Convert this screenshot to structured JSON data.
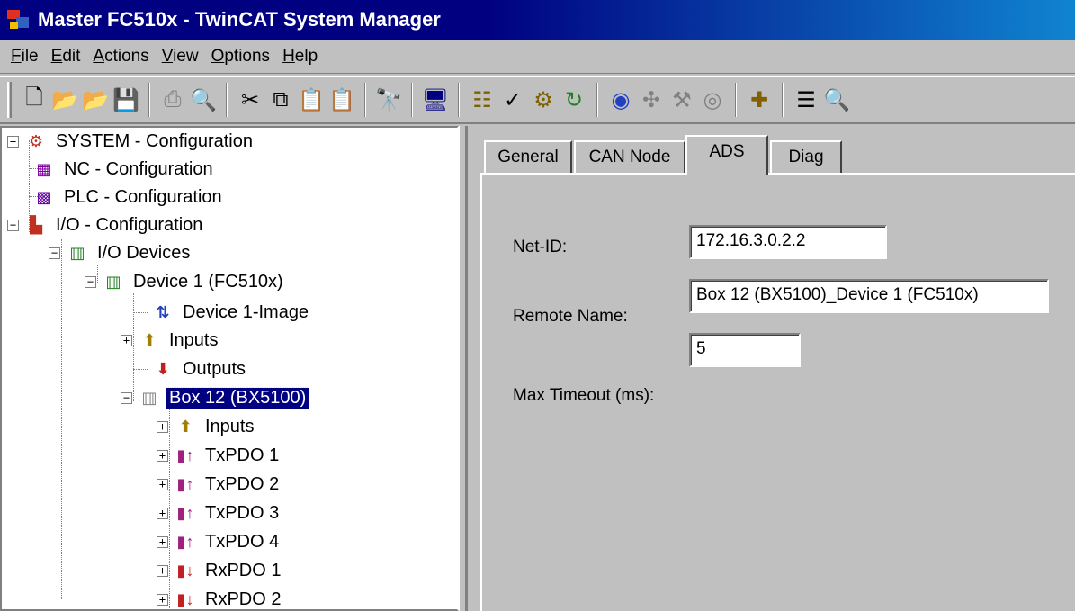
{
  "window": {
    "title": "Master FC510x - TwinCAT System Manager"
  },
  "menu": {
    "items": [
      "File",
      "Edit",
      "Actions",
      "View",
      "Options",
      "Help"
    ]
  },
  "toolbar": {
    "icons": [
      "new-icon",
      "open-icon",
      "open-from-target-icon",
      "save-icon",
      "print-icon",
      "print-preview-icon",
      "cut-icon",
      "copy-icon",
      "paste-icon",
      "paste-with-links-icon",
      "find-icon",
      "target-system-icon",
      "generate-mappings-icon",
      "check-configuration-icon",
      "activate-configuration-icon",
      "restart-icon",
      "online-icon",
      "scan-icon",
      "config-mode-icon",
      "toggle-free-run-icon",
      "add-item-icon",
      "show-properties-icon",
      "zoom-icon"
    ]
  },
  "tree": {
    "items": [
      {
        "label": "SYSTEM - Configuration",
        "icon": "system-config-icon"
      },
      {
        "label": "NC - Configuration",
        "icon": "nc-config-icon"
      },
      {
        "label": "PLC - Configuration",
        "icon": "plc-config-icon"
      },
      {
        "label": "I/O - Configuration",
        "icon": "io-config-icon"
      },
      {
        "label": "I/O Devices",
        "icon": "io-devices-icon"
      },
      {
        "label": "Device 1 (FC510x)",
        "icon": "device-card-icon"
      },
      {
        "label": "Device 1-Image",
        "icon": "process-image-icon"
      },
      {
        "label": "Inputs",
        "icon": "inputs-icon"
      },
      {
        "label": "Outputs",
        "icon": "outputs-icon"
      },
      {
        "label": "Box 12 (BX5100)",
        "icon": "box-terminal-icon"
      },
      {
        "label": "Inputs",
        "icon": "inputs-icon"
      },
      {
        "label": "TxPDO 1",
        "icon": "txpdo-icon"
      },
      {
        "label": "TxPDO 2",
        "icon": "txpdo-icon"
      },
      {
        "label": "TxPDO 3",
        "icon": "txpdo-icon"
      },
      {
        "label": "TxPDO 4",
        "icon": "txpdo-icon"
      },
      {
        "label": "RxPDO 1",
        "icon": "rxpdo-icon"
      },
      {
        "label": "RxPDO 2",
        "icon": "rxpdo-icon"
      }
    ],
    "selected": "Box 12 (BX5100)"
  },
  "tabs": {
    "items": [
      "General",
      "CAN Node",
      "ADS",
      "Diag"
    ],
    "active": "ADS"
  },
  "ads": {
    "netid": {
      "label": "Net-ID:",
      "value": "172.16.3.0.2.2"
    },
    "remote_name": {
      "label": "Remote Name:",
      "value": "Box 12 (BX5100)_Device 1 (FC510x)"
    },
    "timeout": {
      "label": "Max Timeout (ms):",
      "value": "5"
    }
  },
  "colors": {
    "titlebar": "#000080",
    "selection": "#000080",
    "face": "#c0c0c0"
  }
}
